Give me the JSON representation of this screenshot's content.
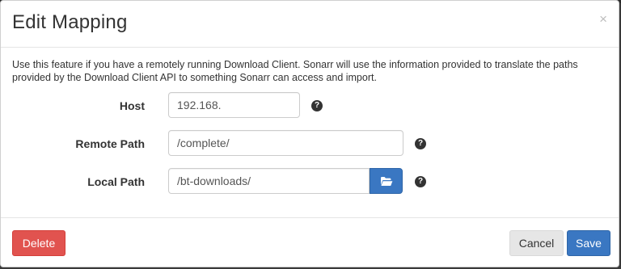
{
  "dialog": {
    "title": "Edit Mapping",
    "close_glyph": "×",
    "description": "Use this feature if you have a remotely running Download Client. Sonarr will use the information provided to translate the paths provided by the Download Client API to something Sonarr can access and import."
  },
  "form": {
    "host": {
      "label": "Host",
      "value": "192.168.",
      "help_icon": "question-circle-icon"
    },
    "remote_path": {
      "label": "Remote Path",
      "value": "/complete/",
      "help_icon": "question-circle-icon"
    },
    "local_path": {
      "label": "Local Path",
      "value": "/bt-downloads/",
      "browse_icon": "folder-open-icon",
      "help_icon": "question-circle-icon"
    }
  },
  "footer": {
    "delete_label": "Delete",
    "cancel_label": "Cancel",
    "save_label": "Save"
  },
  "colors": {
    "primary": "#3a77c2",
    "danger": "#e1534f",
    "default": "#e6e6e6"
  }
}
